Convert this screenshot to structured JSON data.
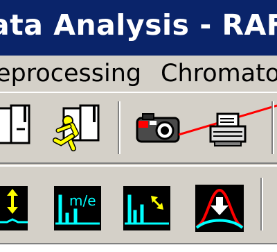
{
  "window": {
    "title": "ata Analysis - RAFAL.M",
    "title_bar_color": "#0a246a"
  },
  "menu": {
    "items": [
      "eprocessing",
      "Chromatog"
    ]
  },
  "toolbar_icons": [
    "open-book-icon",
    "run-method-icon",
    "camera-icon",
    "printer-icon",
    "peak-range-icon",
    "mass-spectrum-icon",
    "chromatogram-zoom-icon",
    "peak-integrate-icon"
  ],
  "colors": {
    "toolbar_bg": "#d4d0c8",
    "icon_bg": "#000000",
    "trace_cyan": "#00ffff",
    "trace_red": "#ff0000",
    "highlight_yellow": "#ffff00"
  }
}
